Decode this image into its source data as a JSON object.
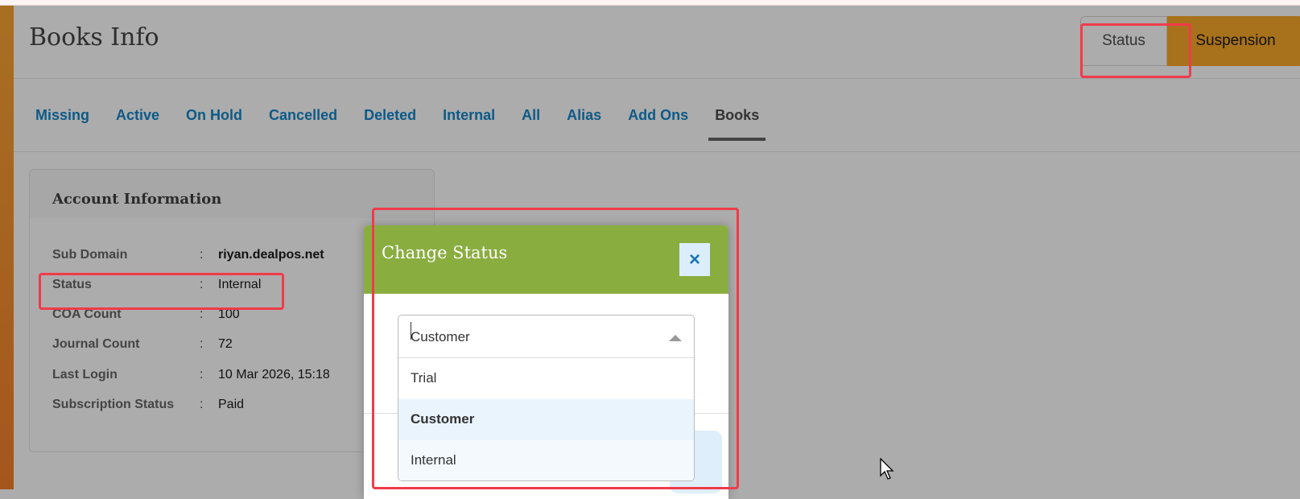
{
  "header": {
    "title": "Books Info",
    "status_button": "Status",
    "suspension_button": "Suspension"
  },
  "tabs": [
    {
      "label": "Missing"
    },
    {
      "label": "Active"
    },
    {
      "label": "On Hold"
    },
    {
      "label": "Cancelled"
    },
    {
      "label": "Deleted"
    },
    {
      "label": "Internal"
    },
    {
      "label": "All"
    },
    {
      "label": "Alias"
    },
    {
      "label": "Add Ons"
    },
    {
      "label": "Books",
      "active": true
    }
  ],
  "account": {
    "title": "Account Information",
    "rows": [
      {
        "key": "Sub Domain",
        "value": "riyan.dealpos.net"
      },
      {
        "key": "Status",
        "value": "Internal"
      },
      {
        "key": "COA Count",
        "value": "100"
      },
      {
        "key": "Journal Count",
        "value": "72"
      },
      {
        "key": "Last Login",
        "value": "10 Mar 2026, 15:18"
      },
      {
        "key": "Subscription Status",
        "value": "Paid"
      }
    ],
    "separator": ":"
  },
  "modal": {
    "title": "Change Status",
    "close_icon": "×",
    "select_value": "Customer",
    "options": [
      "Trial",
      "Customer",
      "Internal"
    ],
    "selected": "Customer"
  },
  "colors": {
    "modal_header": "#8aad40",
    "tab_link": "#0d5a87",
    "suspension": "#a8711b",
    "highlight": "#ef3b4a"
  }
}
